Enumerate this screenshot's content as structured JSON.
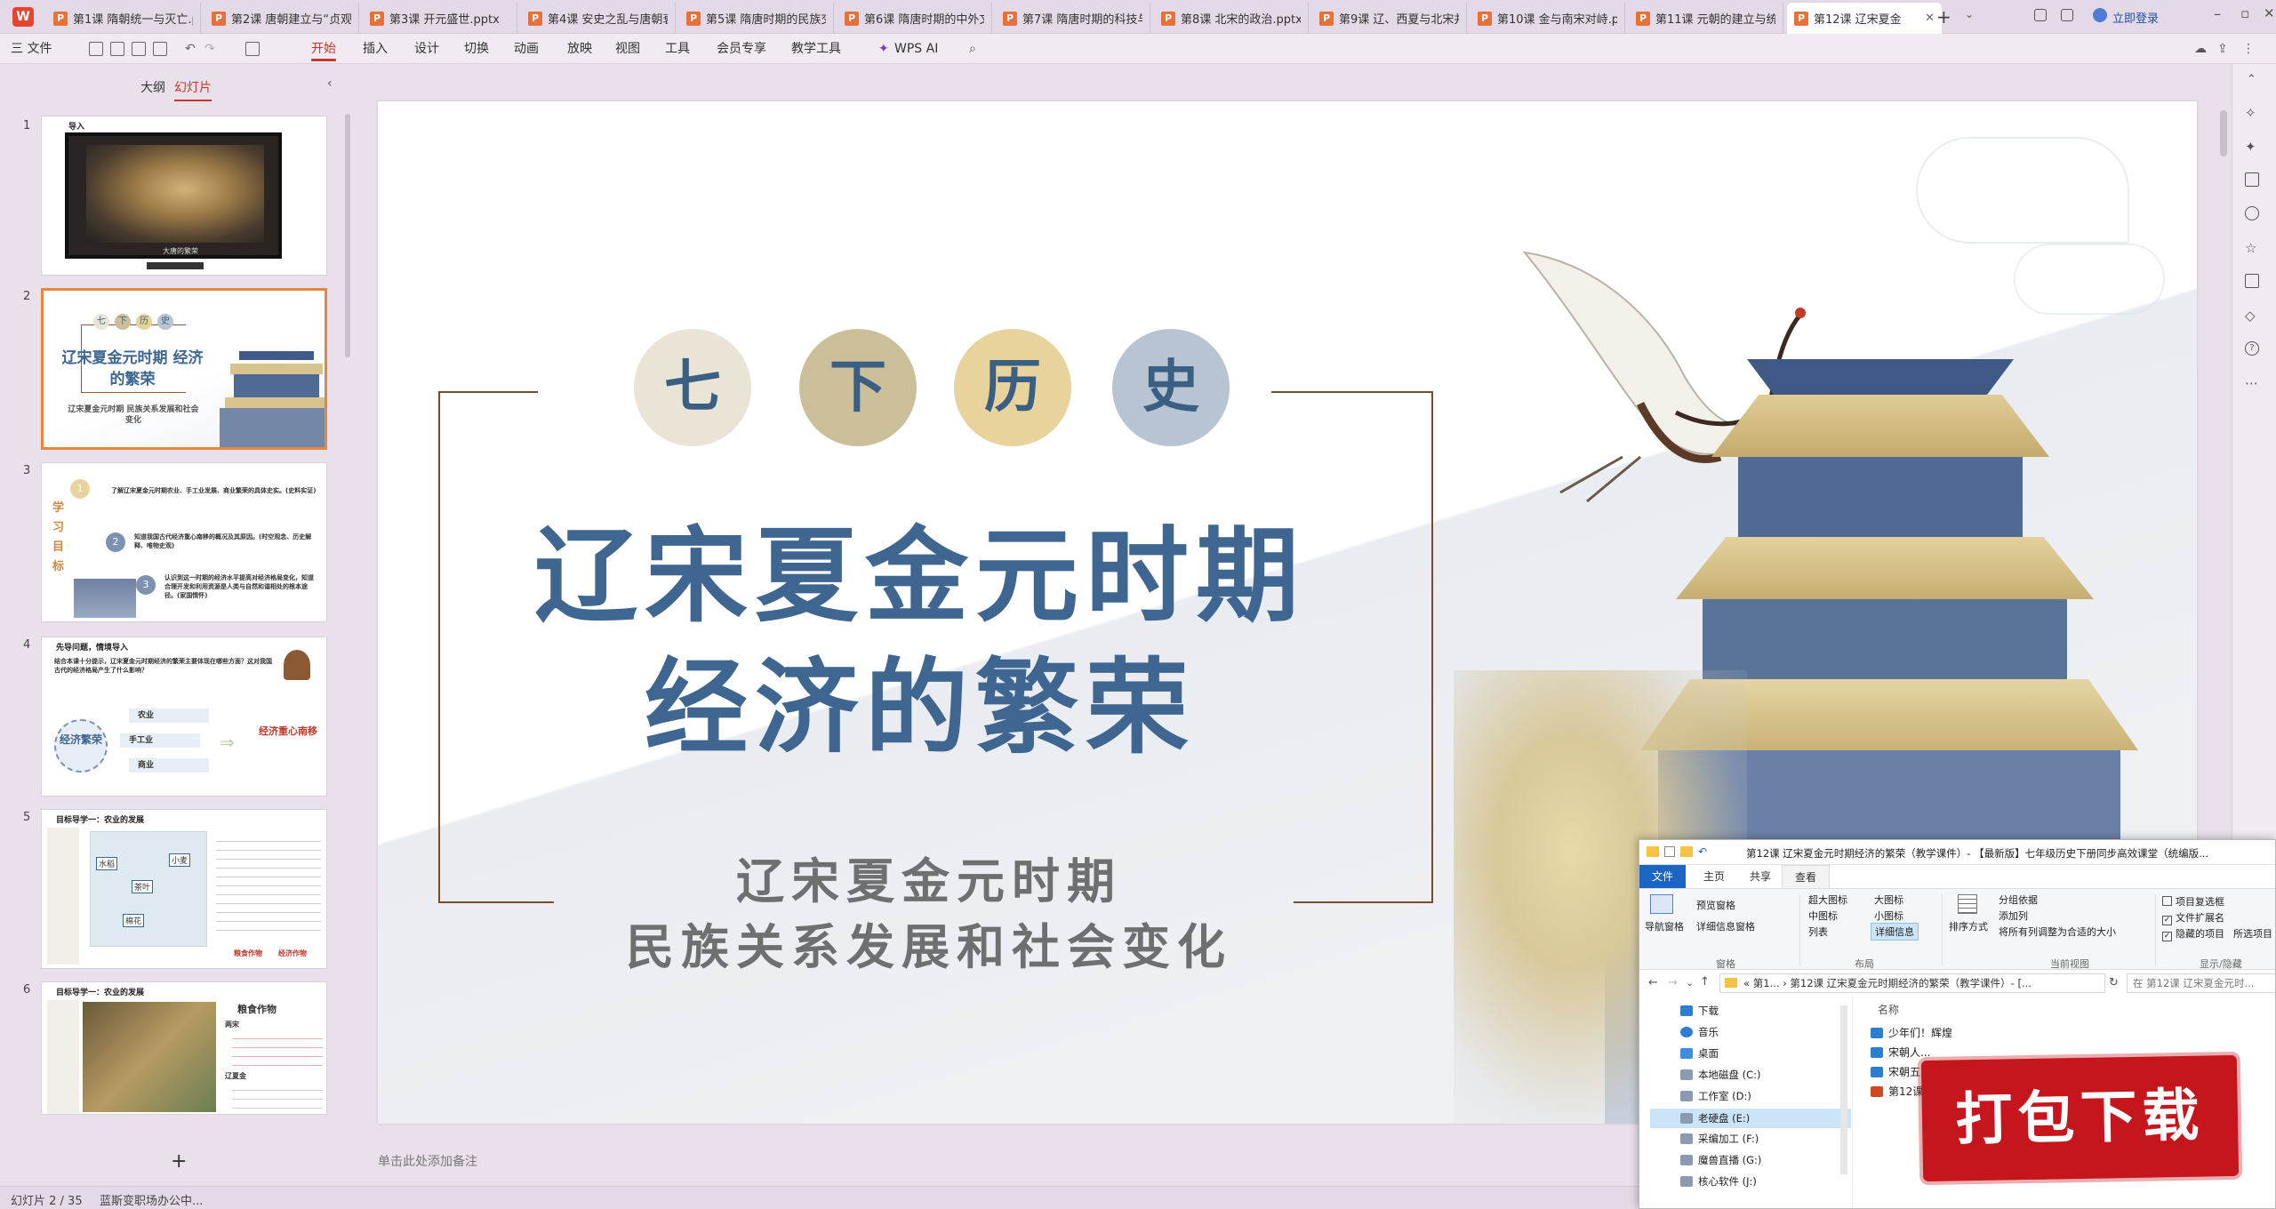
{
  "app": {
    "logo": "W"
  },
  "tabs": [
    {
      "label": "第1课 隋朝统一与灭亡.pp"
    },
    {
      "label": "第2课 唐朝建立与“贞观"
    },
    {
      "label": "第3课 开元盛世.pptx"
    },
    {
      "label": "第4课 安史之乱与唐朝衰"
    },
    {
      "label": "第5课 隋唐时期的民族交"
    },
    {
      "label": "第6课 隋唐时期的中外文"
    },
    {
      "label": "第7课 隋唐时期的科技与"
    },
    {
      "label": "第8课 北宋的政治.pptx"
    },
    {
      "label": "第9课 辽、西夏与北宋并"
    },
    {
      "label": "第10课 金与南宋对峙.pp"
    },
    {
      "label": "第11课 元朝的建立与统一"
    },
    {
      "label": "第12课 辽宋夏金"
    }
  ],
  "titlebar": {
    "login": "立即登录",
    "new_tab": "+"
  },
  "ribbon": {
    "file": "三 文件",
    "menu": [
      "开始",
      "插入",
      "设计",
      "切换",
      "动画",
      "放映",
      "视图",
      "工具",
      "会员专享",
      "教学工具"
    ],
    "active": "开始",
    "ai": "WPS AI"
  },
  "leftpane": {
    "tabs": [
      "大纲",
      "幻灯片"
    ],
    "active": "幻灯片",
    "add": "+",
    "slides": [
      {
        "num": "1",
        "title": "导入",
        "caption": "大唐的繁荣"
      },
      {
        "num": "2",
        "title": "辽宋夏金元时期 经济的繁荣",
        "chars": [
          "七",
          "下",
          "历",
          "史"
        ],
        "sub": "辽宋夏金元时期 民族关系发展和社会变化"
      },
      {
        "num": "3",
        "side": "学习目标",
        "items": [
          "了解辽宋夏金元时期农业、手工业发展、商业繁荣的具体史实。(史料实证)",
          "知道我国古代经济重心南移的概况及其原因。(时空观念、历史解释、唯物史观)",
          "认识到这一时期的经济水平提高对经济格局变化，知道合理开发和利用资源是人类与自然和谐相处的根本途径。(家国情怀)"
        ]
      },
      {
        "num": "4",
        "title": "先导问题，情境导入",
        "q": "结合本课十分提示，辽宋夏金元时期经济的繁荣主要体现在哪些方面？这对我国古代的经济格局产生了什么影响？",
        "center": "经济繁荣",
        "branches": [
          "农业",
          "手工业",
          "商业"
        ],
        "result": "经济重心南移"
      },
      {
        "num": "5",
        "title": "目标导学一：农业的发展",
        "labels": [
          "水稻",
          "小麦",
          "茶叶",
          "棉花"
        ],
        "foot": [
          "粮食作物",
          "经济作物"
        ]
      },
      {
        "num": "6",
        "title": "目标导学一：农业的发展",
        "crop": "粮食作物",
        "items": [
          "两宋",
          "辽夏金"
        ]
      }
    ]
  },
  "slide": {
    "chars": [
      "七",
      "下",
      "历",
      "史"
    ],
    "char_colors": [
      "#e9e4d5",
      "#cbbf9a",
      "#e8d39c",
      "#b8c4d1"
    ],
    "title_line1": "辽宋夏金元时期",
    "title_line2": "经济的繁荣",
    "subtitle_line1": "辽宋夏金元时期",
    "subtitle_line2": "民族关系发展和社会变化"
  },
  "notes_placeholder": "单击此处添加备注",
  "statusbar": {
    "slide_pos": "幻灯片 2 / 35",
    "office": "蓝斯变职场办公中..."
  },
  "explorer": {
    "title": "第12课 辽宋夏金元时期经济的繁荣（教学课件）- 【最新版】七年级历史下册同步高效课堂（统编版...",
    "ribbon_tabs": [
      "文件",
      "主页",
      "共享",
      "查看"
    ],
    "active_tab": "查看",
    "groups": [
      "窗格",
      "布局",
      "当前视图",
      "显示/隐藏"
    ],
    "pane_items": [
      "导航窗格",
      "预览窗格",
      "详细信息窗格"
    ],
    "layout_items": [
      "超大图标",
      "大图标",
      "中图标",
      "小图标",
      "列表",
      "详细信息"
    ],
    "view_items": [
      "排序方式",
      "分组依据",
      "添加列",
      "将所有列调整为合适的大小"
    ],
    "show_items": [
      "项目复选框",
      "文件扩展名",
      "隐藏的项目",
      "所选项目"
    ],
    "address": "« 第1... › 第12课 辽宋夏金元时期经济的繁荣（教学课件）- [...",
    "search": "在 第12课 辽宋夏金元时...",
    "nav": [
      "下载",
      "音乐",
      "桌面",
      "本地磁盘 (C:)",
      "工作室 (D:)",
      "老硬盘 (E:)",
      "采编加工 (F:)",
      "魔兽直播 (G:)",
      "核心软件 (J:)"
    ],
    "column": "名称",
    "files": [
      "少年们！辉煌",
      "宋朝人...",
      "宋朝五...",
      "第12课"
    ]
  },
  "stamp": "打包下载"
}
